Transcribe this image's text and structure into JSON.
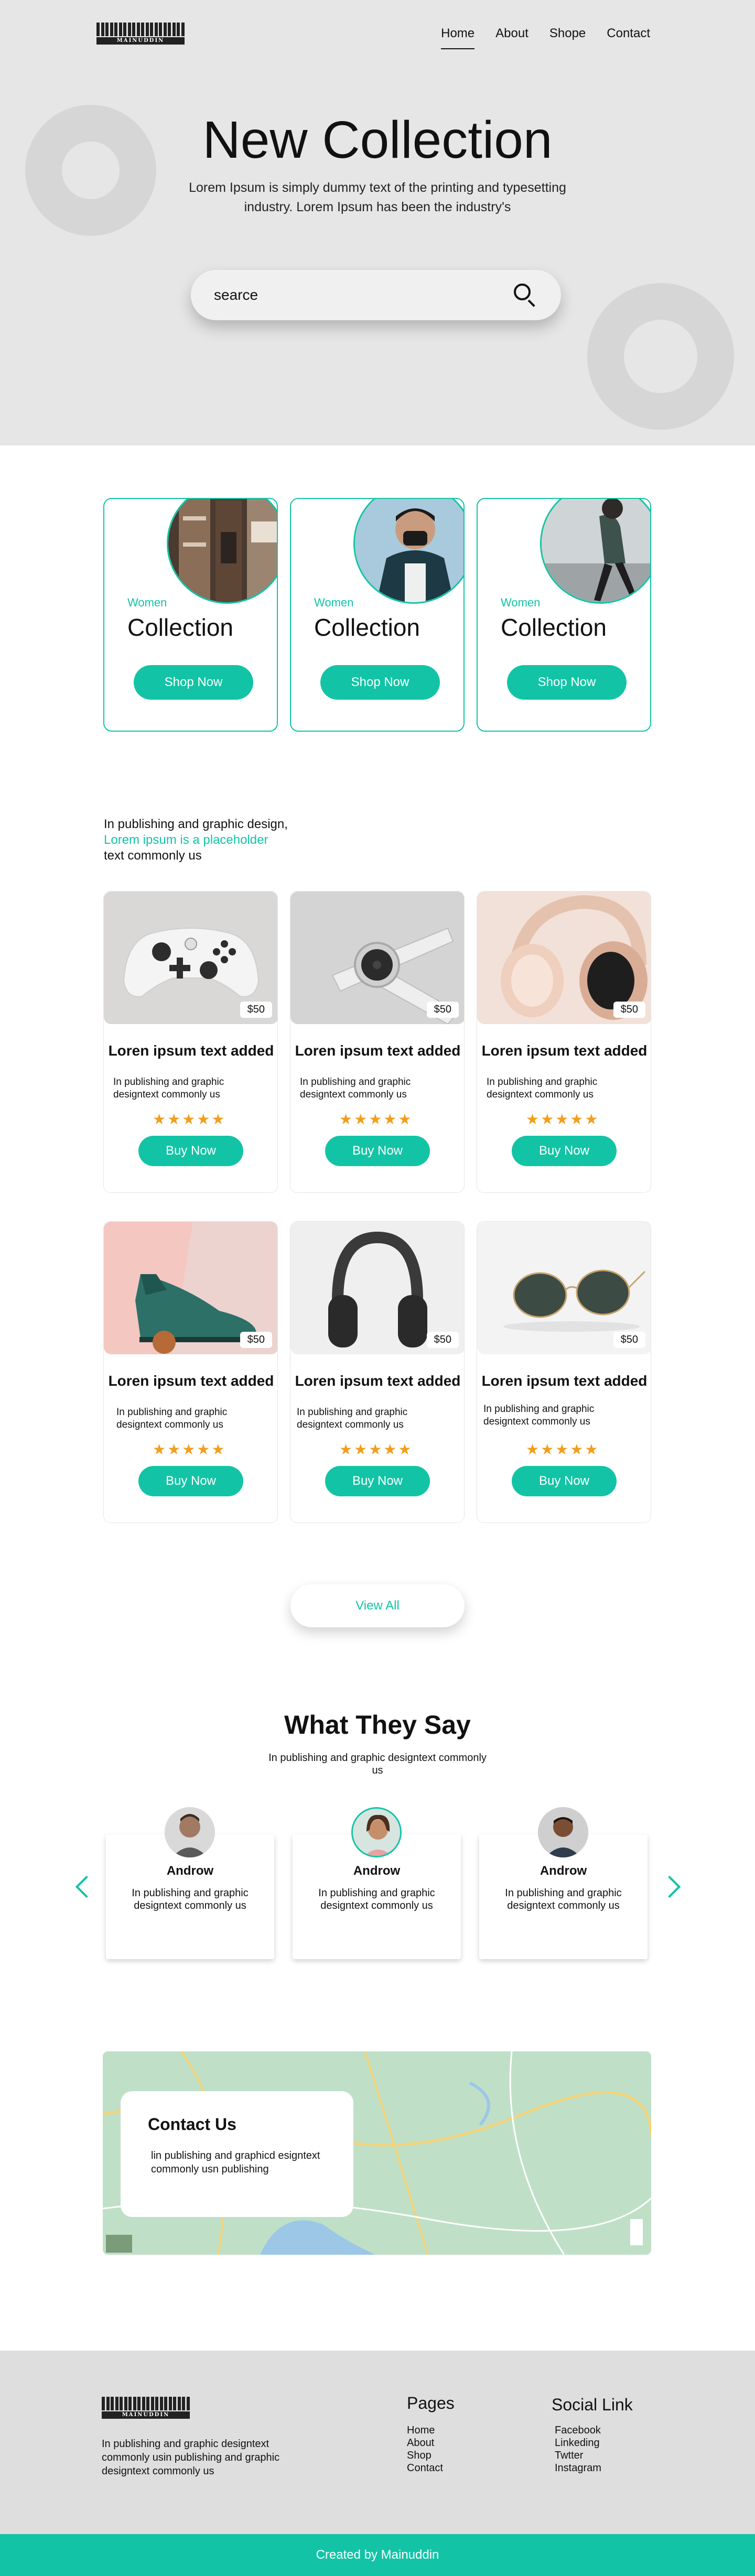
{
  "brand": {
    "logo_text": "MAINUDDIN"
  },
  "nav": {
    "items": [
      {
        "label": "Home"
      },
      {
        "label": "About"
      },
      {
        "label": "Shope"
      },
      {
        "label": "Contact"
      }
    ]
  },
  "hero": {
    "title": "New Collection",
    "description": "Lorem Ipsum is simply dummy text of the printing and typesetting industry. Lorem Ipsum has been the industry's",
    "search_value": "searce"
  },
  "collections": [
    {
      "tag": "Women",
      "title": "Collection",
      "button": "Shop Now"
    },
    {
      "tag": "Women",
      "title": "Collection",
      "button": "Shop Now"
    },
    {
      "tag": "Women",
      "title": "Collection",
      "button": "Shop Now"
    }
  ],
  "intro": {
    "line1": "In publishing and graphic design,",
    "line2": "Lorem ipsum is a placeholder",
    "line3": "text commonly us"
  },
  "products": [
    {
      "image": "game-controller",
      "price": "$50",
      "title": "Loren ipsum text added",
      "desc": "In publishing and graphic designtext commonly us",
      "rating": 5,
      "button": "Buy Now"
    },
    {
      "image": "smart-watch",
      "price": "$50",
      "title": "Loren ipsum text added",
      "desc": "In publishing and graphic designtext commonly us",
      "rating": 5,
      "button": "Buy Now"
    },
    {
      "image": "headphones-beige",
      "price": "$50",
      "title": "Loren ipsum text added",
      "desc": "In publishing and graphic designtext commonly us",
      "rating": 5,
      "button": "Buy Now"
    },
    {
      "image": "green-shoe",
      "price": "$50",
      "title": "Loren ipsum text added",
      "desc": "In publishing and graphic designtext commonly us",
      "rating": 5,
      "button": "Buy Now"
    },
    {
      "image": "headphones-black",
      "price": "$50",
      "title": "Loren ipsum text added",
      "desc": "In publishing and graphic designtext commonly us",
      "rating": 5,
      "button": "Buy Now"
    },
    {
      "image": "sunglasses",
      "price": "$50",
      "title": "Loren ipsum text added",
      "desc": "In publishing and graphic designtext commonly us",
      "rating": 5,
      "button": "Buy Now"
    }
  ],
  "view_all": "View All",
  "testimonials": {
    "title": "What They Say",
    "subtitle": "In publishing and graphic designtext commonly us",
    "items": [
      {
        "name": "Androw",
        "text": "In publishing and graphic designtext commonly us"
      },
      {
        "name": "Androw",
        "text": "In publishing and graphic designtext commonly us"
      },
      {
        "name": "Androw",
        "text": "In publishing and graphic designtext commonly us"
      }
    ]
  },
  "contact": {
    "title": "Contact Us",
    "text": "lin publishing and graphicd esigntext commonly usn publishing"
  },
  "footer": {
    "description": "In publishing and graphic designtext commonly usin publishing and graphic designtext commonly us",
    "pages_title": "Pages",
    "pages": [
      "Home",
      "About",
      "Shop",
      "Contact"
    ],
    "social_title": "Social Link",
    "social": [
      "Facebook",
      "Linkeding",
      "Twtter",
      "Instagram"
    ],
    "copyright": "Created by Mainuddin"
  },
  "colors": {
    "accent": "#12c4a5",
    "hero_bg": "#e6e6e6",
    "footer_bg": "#dedede",
    "star": "#f29e1c"
  }
}
